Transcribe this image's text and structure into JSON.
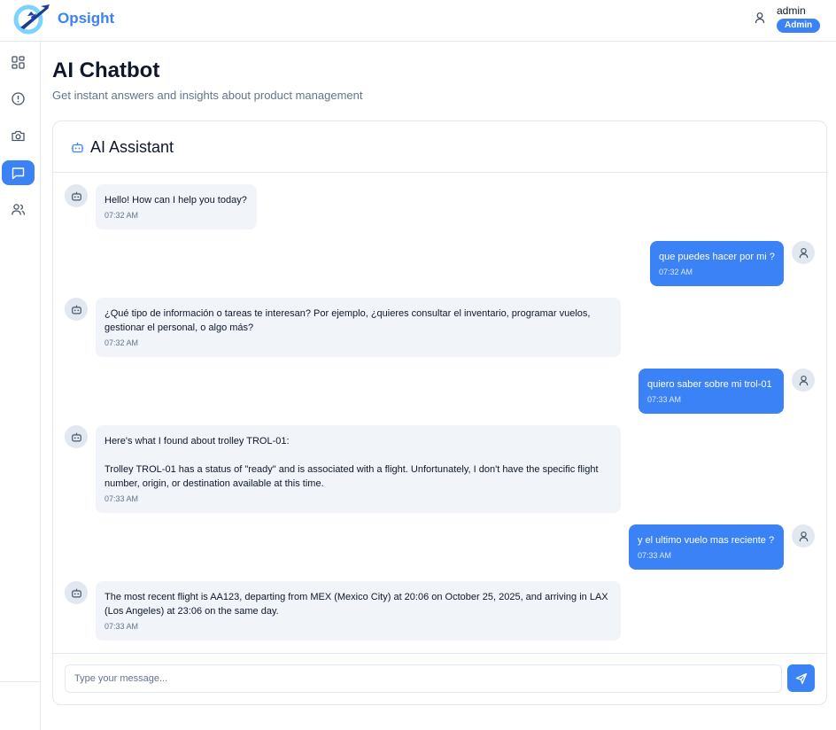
{
  "app": {
    "name": "Opsight"
  },
  "colors": {
    "accent": "#3b82f6",
    "muted": "#64748b",
    "bubble_bot": "#f1f5f9",
    "border": "#e2e8f0"
  },
  "user": {
    "name": "admin",
    "role": "Admin"
  },
  "sidebar": {
    "items": [
      {
        "icon": "dashboard-icon",
        "active": false
      },
      {
        "icon": "alert-circle-icon",
        "active": false
      },
      {
        "icon": "camera-icon",
        "active": false
      },
      {
        "icon": "chat-icon",
        "active": true
      },
      {
        "icon": "users-icon",
        "active": false
      }
    ]
  },
  "page": {
    "title": "AI Chatbot",
    "subtitle": "Get instant answers and insights about product management"
  },
  "chat": {
    "title": "AI Assistant",
    "messages": [
      {
        "role": "bot",
        "text": "Hello! How can I help you today?",
        "time": "07:32 AM"
      },
      {
        "role": "user",
        "text": "que puedes hacer por mi ?",
        "time": "07:32 AM"
      },
      {
        "role": "bot",
        "text": "¿Qué tipo de información o tareas te interesan? Por ejemplo, ¿quieres consultar el inventario, programar vuelos, gestionar el personal, o algo más?",
        "time": "07:32 AM"
      },
      {
        "role": "user",
        "text": "quiero saber sobre mi trol-01",
        "time": "07:33 AM"
      },
      {
        "role": "bot",
        "text": "Here's what I found about trolley TROL-01:\n\nTrolley TROL-01 has a status of \"ready\" and is associated with a flight. Unfortunately, I don't have the specific flight number, origin, or destination available at this time.",
        "time": "07:33 AM"
      },
      {
        "role": "user",
        "text": "y el ultimo vuelo mas reciente ?",
        "time": "07:33 AM"
      },
      {
        "role": "bot",
        "text": "The most recent flight is AA123, departing from MEX (Mexico City) at 20:06 on October 25, 2025, and arriving in LAX (Los Angeles) at 23:06 on the same day.",
        "time": "07:33 AM"
      }
    ],
    "input": {
      "placeholder": "Type your message...",
      "value": ""
    },
    "send_icon": "send-icon"
  }
}
